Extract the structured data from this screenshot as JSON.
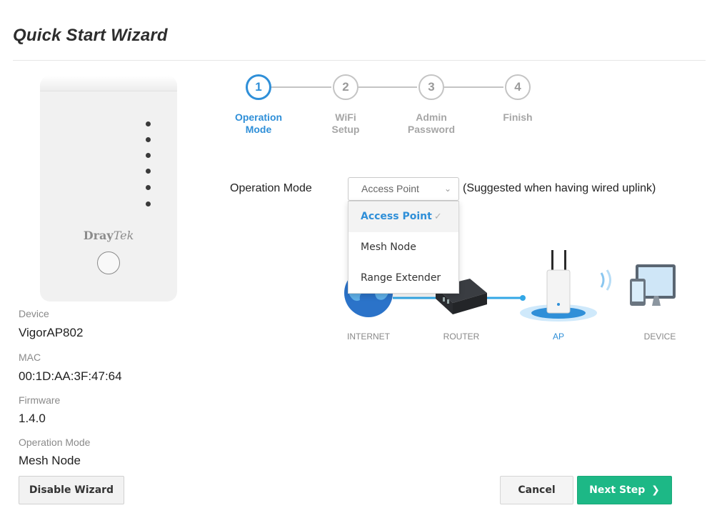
{
  "title": "Quick Start Wizard",
  "steps": [
    {
      "num": "1",
      "label": "Operation\nMode",
      "state": "active"
    },
    {
      "num": "2",
      "label": "WiFi\nSetup",
      "state": "pending"
    },
    {
      "num": "3",
      "label": "Admin\nPassword",
      "state": "pending"
    },
    {
      "num": "4",
      "label": "Finish",
      "state": "pending"
    }
  ],
  "device": {
    "brand_bold": "Dray",
    "brand_italic": "Tek",
    "info": [
      {
        "label": "Device",
        "value": "VigorAP802"
      },
      {
        "label": "MAC",
        "value": "00:1D:AA:3F:47:64"
      },
      {
        "label": "Firmware",
        "value": "1.4.0"
      },
      {
        "label": "Operation Mode",
        "value": "Mesh Node"
      }
    ]
  },
  "form": {
    "operation_mode_label": "Operation Mode",
    "selected_value": "Access Point",
    "hint": "(Suggested when having wired uplink)",
    "options": [
      "Access Point",
      "Mesh Node",
      "Range Extender"
    ]
  },
  "diagram": {
    "labels": [
      "INTERNET",
      "ROUTER",
      "AP",
      "DEVICE"
    ]
  },
  "buttons": {
    "disable_wizard": "Disable Wizard",
    "cancel": "Cancel",
    "next_step": "Next Step"
  },
  "colors": {
    "accent": "#2f8fd8",
    "next_button": "#1db886",
    "step_inactive": "#c4c4c4"
  }
}
